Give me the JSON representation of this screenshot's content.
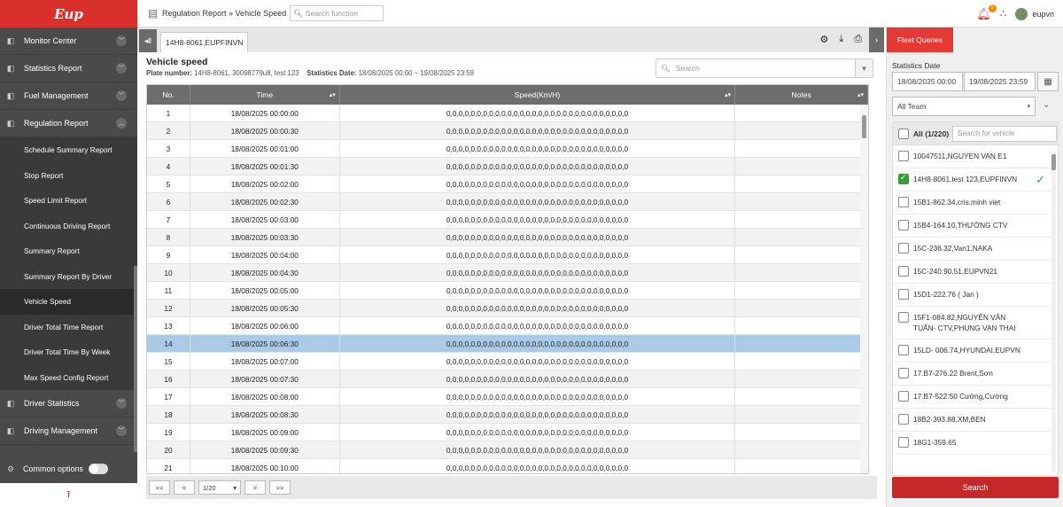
{
  "app": {
    "logo_text": "Eup",
    "brand_color": "#d9302b"
  },
  "sidebar": {
    "menu": [
      {
        "label": "Monitor Center",
        "icon": "monitor-icon",
        "expanded": false
      },
      {
        "label": "Statistics Report",
        "icon": "bar-chart-icon",
        "expanded": false
      },
      {
        "label": "Fuel Management",
        "icon": "fuel-icon",
        "expanded": false
      },
      {
        "label": "Regulation Report",
        "icon": "regulation-icon",
        "expanded": true
      }
    ],
    "submenu": [
      {
        "label": "Schedule Summary Report",
        "active": false
      },
      {
        "label": "Stop Report",
        "active": false
      },
      {
        "label": "Speed Limit Report",
        "active": false
      },
      {
        "label": "Continuous Driving Report",
        "active": false
      },
      {
        "label": "Summary Report",
        "active": false
      },
      {
        "label": "Summary Report By Driver",
        "active": false
      },
      {
        "label": "Vehicle Speed",
        "active": true
      },
      {
        "label": "Driver Total Time Report",
        "active": false
      },
      {
        "label": "Driver Total Time By Week",
        "active": false
      },
      {
        "label": "Max Speed Config Report",
        "active": false
      }
    ],
    "menu_after": [
      {
        "label": "Driver Statistics",
        "icon": "driver-icon",
        "expanded": false
      },
      {
        "label": "Driving Management",
        "icon": "car-icon",
        "expanded": false
      }
    ],
    "common_options": "Common options"
  },
  "topbar": {
    "breadcrumb": "Regulation Report » Vehicle Speed",
    "search_placeholder": "Search function",
    "notification_count": "5",
    "username": "eupvn"
  },
  "tabs": {
    "active_vehicle": "14H8-8061,EUPFINVN"
  },
  "report": {
    "title": "Vehicle speed",
    "plate_label": "Plate number:",
    "plate_value": "14H8-8061, 30098779u8, test 123",
    "date_label": "Statistics Date:",
    "date_value": "18/08/2025 00:00 ~ 19/08/2025 23:59",
    "search_placeholder": "Search"
  },
  "table": {
    "columns": [
      "No.",
      "Time",
      "Speed(Km/H)",
      "Notes"
    ],
    "selected_row": 14,
    "speed_text": "0,0,0,0,0,0,0,0,0,0,0,0,0,0,0,0,0,0,0,0,0,0,0,0,0,0,0,0,0,0",
    "rows": [
      {
        "no": "1",
        "time": "18/08/2025 00:00:00"
      },
      {
        "no": "2",
        "time": "18/08/2025 00:00:30"
      },
      {
        "no": "3",
        "time": "18/08/2025 00:01:00"
      },
      {
        "no": "4",
        "time": "18/08/2025 00:01:30"
      },
      {
        "no": "5",
        "time": "18/08/2025 00:02:00"
      },
      {
        "no": "6",
        "time": "18/08/2025 00:02:30"
      },
      {
        "no": "7",
        "time": "18/08/2025 00:03:00"
      },
      {
        "no": "8",
        "time": "18/08/2025 00:03:30"
      },
      {
        "no": "9",
        "time": "18/08/2025 00:04:00"
      },
      {
        "no": "10",
        "time": "18/08/2025 00:04:30"
      },
      {
        "no": "11",
        "time": "18/08/2025 00:05:00"
      },
      {
        "no": "12",
        "time": "18/08/2025 00:05:30"
      },
      {
        "no": "13",
        "time": "18/08/2025 00:06:00"
      },
      {
        "no": "14",
        "time": "18/08/2025 00:06:30"
      },
      {
        "no": "15",
        "time": "18/08/2025 00:07:00"
      },
      {
        "no": "16",
        "time": "18/08/2025 00:07:30"
      },
      {
        "no": "17",
        "time": "18/08/2025 00:08:00"
      },
      {
        "no": "18",
        "time": "18/08/2025 00:08:30"
      },
      {
        "no": "19",
        "time": "18/08/2025 00:09:00"
      },
      {
        "no": "20",
        "time": "18/08/2025 00:09:30"
      },
      {
        "no": "21",
        "time": "18/08/2025 00:10:00"
      }
    ]
  },
  "pager": {
    "first": "<<",
    "prev": "<",
    "page": "1/20",
    "next": ">",
    "last": ">>"
  },
  "right_panel": {
    "tab_label": "Fleet Queries",
    "stats_date_label": "Statistics Date",
    "date_from": "18/08/2025 00:00",
    "date_to": "19/08/2025 23:59",
    "team": "All Team",
    "all_label": "All (1/220)",
    "vehicle_search_placeholder": "Search for vehicle",
    "vehicles": [
      {
        "label": "10047511,NGUYEN VAN E1",
        "checked": false
      },
      {
        "label": "14H8-8061,test 123,EUPFINVN",
        "checked": true
      },
      {
        "label": "15B1-862.34,cris,minh viet",
        "checked": false
      },
      {
        "label": "15B4-164.10,THƯỜNG CTV",
        "checked": false
      },
      {
        "label": "15C-236.32,Van1,NAKA",
        "checked": false
      },
      {
        "label": "15C-240.90,51,EUPVN21",
        "checked": false
      },
      {
        "label": "15D1-222.76 ( Jan )",
        "checked": false
      },
      {
        "label": "15F1-084.82,NGUYỄN VĂN TUẤN- CTV,PHUNG VAN THAI",
        "checked": false
      },
      {
        "label": "15LD- 006.74,HYUNDAI,EUPVN",
        "checked": false
      },
      {
        "label": "17.B7-276.22 Brent,Sơn",
        "checked": false
      },
      {
        "label": "17.B7-522.50 Cường,Cường",
        "checked": false
      },
      {
        "label": "18B2-393.88,XM,BEN",
        "checked": false
      },
      {
        "label": "18G1-359.65",
        "checked": false
      }
    ],
    "search_button": "Search"
  }
}
